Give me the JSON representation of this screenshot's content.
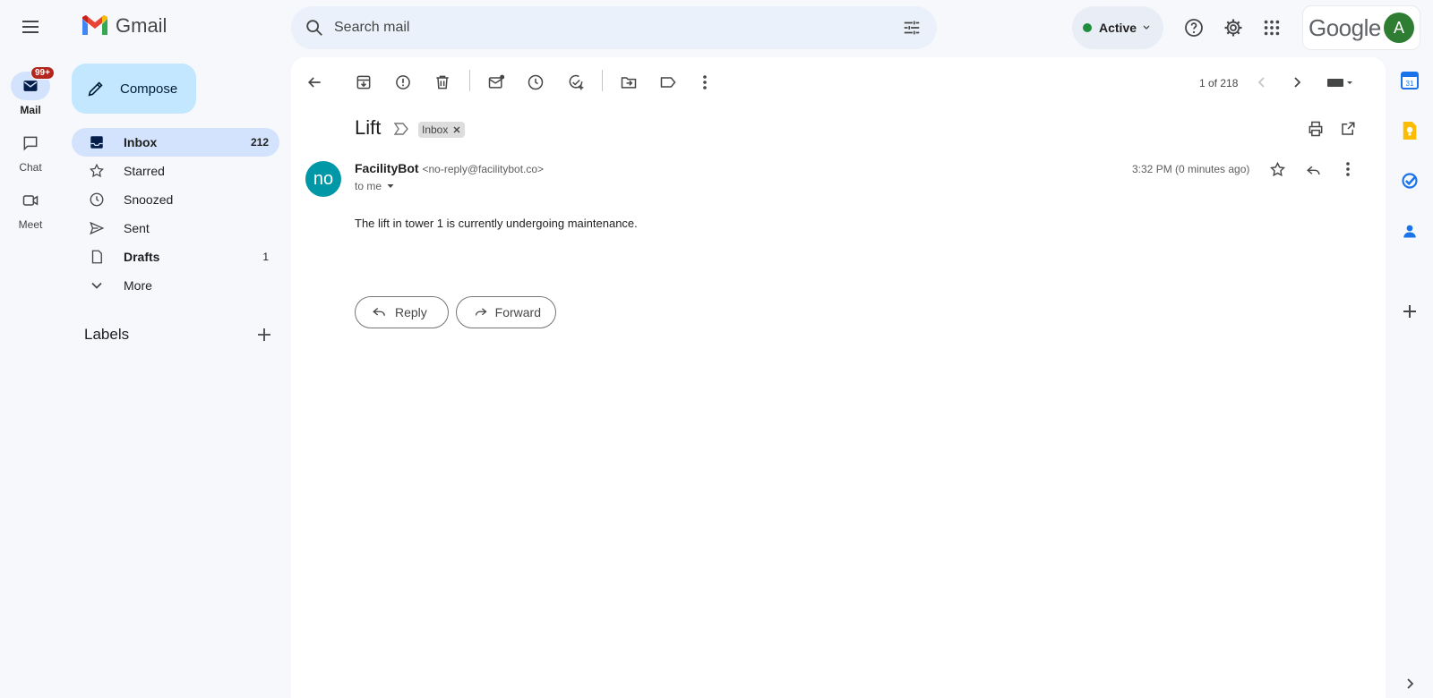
{
  "app": {
    "name": "Gmail"
  },
  "rail": {
    "mail_label": "Mail",
    "mail_badge": "99+",
    "chat_label": "Chat",
    "meet_label": "Meet"
  },
  "search": {
    "placeholder": "Search mail"
  },
  "header": {
    "status": "Active",
    "brand": "Google",
    "avatar_letter": "A"
  },
  "nav": {
    "compose_label": "Compose",
    "items": [
      {
        "label": "Inbox",
        "count": "212"
      },
      {
        "label": "Starred",
        "count": ""
      },
      {
        "label": "Snoozed",
        "count": ""
      },
      {
        "label": "Sent",
        "count": ""
      },
      {
        "label": "Drafts",
        "count": "1"
      },
      {
        "label": "More",
        "count": ""
      }
    ],
    "labels_heading": "Labels"
  },
  "toolbar": {
    "pagination": "1 of 218"
  },
  "email": {
    "subject": "Lift",
    "label_chip": "Inbox",
    "avatar_text": "no",
    "sender_name": "FacilityBot",
    "sender_email": "<no-reply@facilitybot.co>",
    "recipient": "to me",
    "time": "3:32 PM (0 minutes ago)",
    "body": "The lift in tower 1 is currently undergoing maintenance.",
    "reply_label": "Reply",
    "forward_label": "Forward"
  },
  "colors": {
    "background": "#f6f8fc",
    "compose": "#c2e7ff",
    "nav_active": "#d3e3fd",
    "avatar": "#0097a7",
    "badge": "#b3261e",
    "status_dot": "#1e8e3e"
  }
}
